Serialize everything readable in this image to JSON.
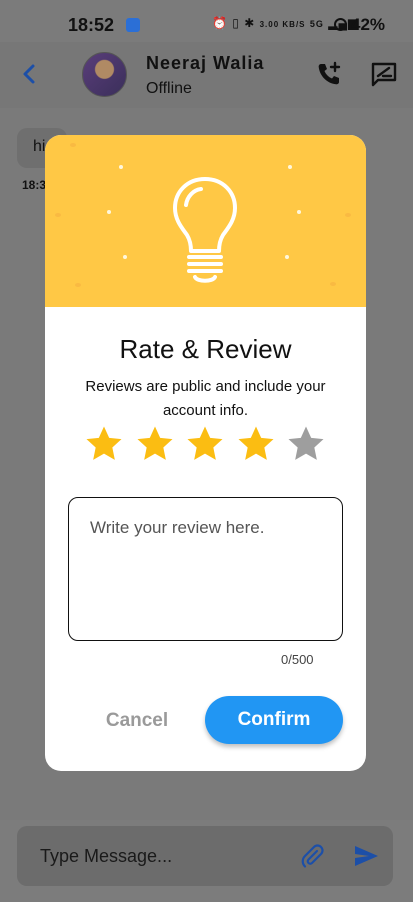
{
  "status_bar": {
    "time": "18:52",
    "net_speed": "3.00 KB/S",
    "indicators": "5G",
    "battery": "42%"
  },
  "header": {
    "contact_name": "Neeraj Walia",
    "contact_status": "Offline",
    "icons": [
      "back-arrow-icon",
      "add-call-icon",
      "chat-edit-icon"
    ]
  },
  "chat": {
    "message_text": "hi",
    "message_time": "18:3"
  },
  "composer": {
    "placeholder": "Type Message...",
    "icons": [
      "paperclip-icon",
      "send-icon"
    ]
  },
  "dialog": {
    "title": "Rate & Review",
    "subtitle": "Reviews are public and include your account info.",
    "rating": 4,
    "max_rating": 5,
    "review_placeholder": "Write your review here.",
    "char_count": "0/500",
    "cancel_label": "Cancel",
    "confirm_label": "Confirm"
  },
  "colors": {
    "banner": "#ffc845",
    "star_filled": "#fbbd12",
    "star_empty": "#9e9e9e",
    "confirm": "#2196f3",
    "accent_icon": "#1c4fa8"
  }
}
